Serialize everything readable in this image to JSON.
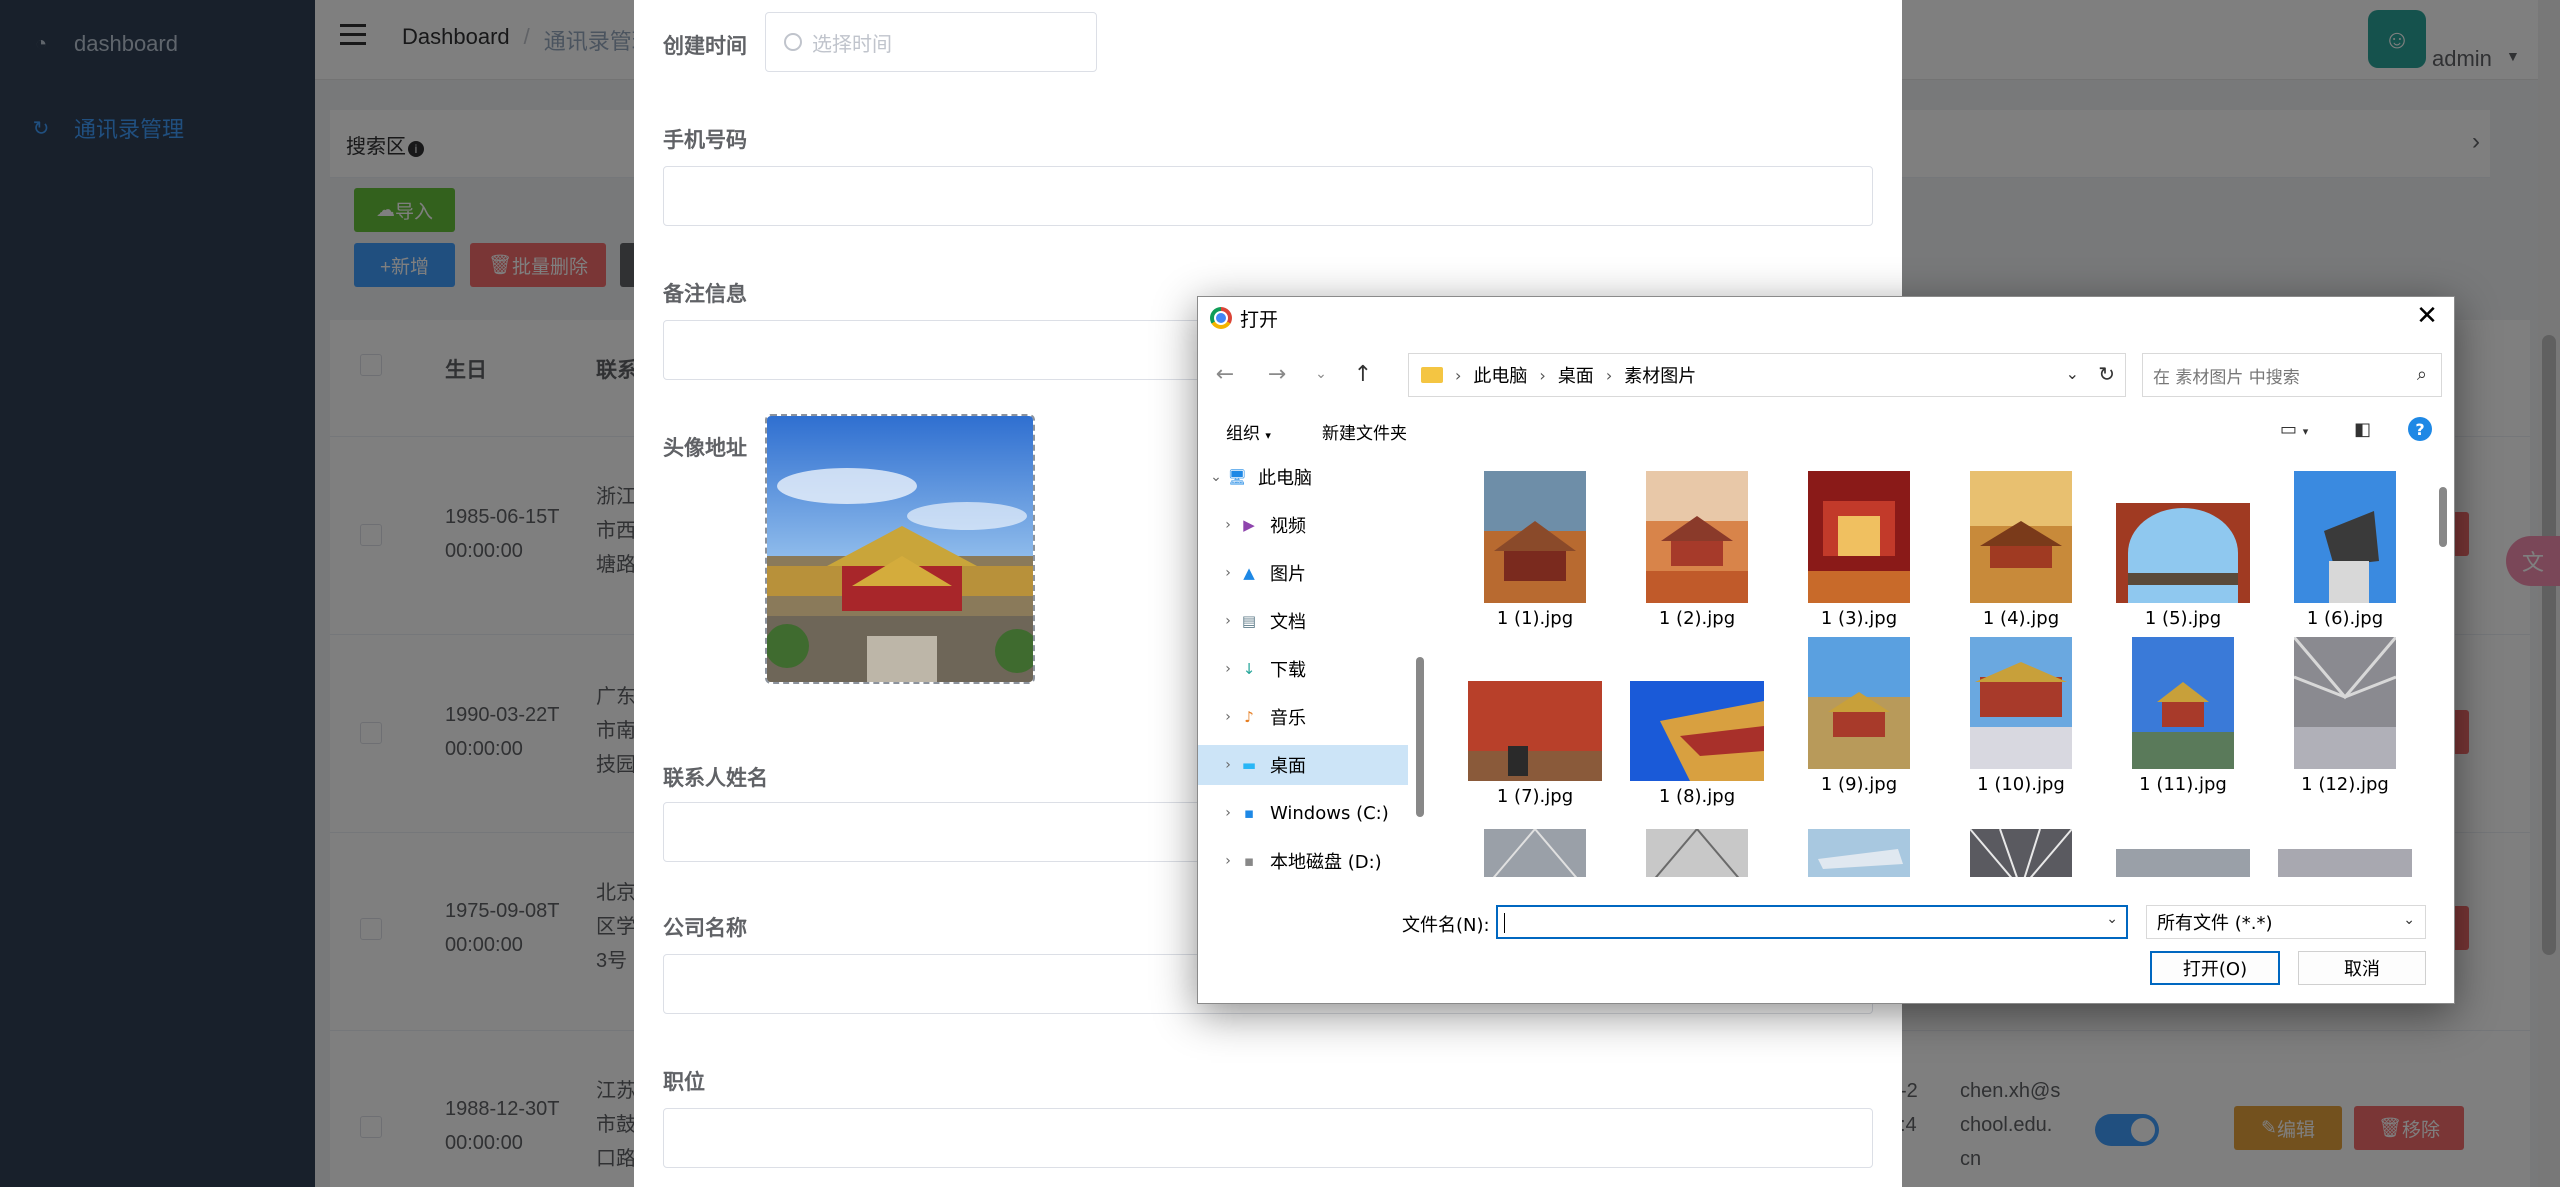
{
  "sidebar": {
    "items": [
      {
        "label": "dashboard",
        "icon": "dashboard-icon"
      },
      {
        "label": "通讯录管理",
        "icon": "contacts-icon"
      }
    ]
  },
  "header": {
    "breadcrumb": [
      "Dashboard",
      "通讯录管理"
    ],
    "user": "admin"
  },
  "search": {
    "title": "搜索区"
  },
  "toolbar": {
    "import_label": "导入",
    "add_label": "+新增",
    "batch_delete_label": "批量删除"
  },
  "table": {
    "headers": [
      "生日",
      "联系"
    ],
    "rows": [
      {
        "birthday": "1985-06-15T\n00:00:00",
        "address": "浙江\n市西\n塘路"
      },
      {
        "birthday": "1990-03-22T\n00:00:00",
        "address": "广东\n市南\n技园"
      },
      {
        "birthday": "1975-09-08T\n00:00:00",
        "address": "北京\n区学\n3号"
      },
      {
        "birthday": "1988-12-30T\n00:00:00",
        "address": "江苏\n市鼓\n口路",
        "email": "chen.xh@s\nchool.edu.\ncn",
        "date_frag": "-2\n:4"
      }
    ],
    "edit_label": "编辑",
    "remove_label": "移除"
  },
  "form": {
    "created_time_label": "创建时间",
    "created_time_placeholder": "选择时间",
    "phone_label": "手机号码",
    "remark_label": "备注信息",
    "avatar_label": "头像地址",
    "name_label": "联系人姓名",
    "company_label": "公司名称",
    "position_label": "职位"
  },
  "dialog": {
    "title": "打开",
    "path": [
      "此电脑",
      "桌面",
      "素材图片"
    ],
    "search_placeholder": "在 素材图片 中搜索",
    "organize": "组织",
    "new_folder": "新建文件夹",
    "tree": [
      {
        "label": "此电脑",
        "icon": "computer-icon"
      },
      {
        "label": "视频",
        "icon": "video-icon"
      },
      {
        "label": "图片",
        "icon": "pictures-icon"
      },
      {
        "label": "文档",
        "icon": "documents-icon"
      },
      {
        "label": "下载",
        "icon": "download-icon"
      },
      {
        "label": "音乐",
        "icon": "music-icon"
      },
      {
        "label": "桌面",
        "icon": "desktop-icon"
      },
      {
        "label": "Windows (C:)",
        "icon": "drive-icon"
      },
      {
        "label": "本地磁盘 (D:)",
        "icon": "drive-icon"
      }
    ],
    "files": [
      "1 (1).jpg",
      "1 (2).jpg",
      "1 (3).jpg",
      "1 (4).jpg",
      "1 (5).jpg",
      "1 (6).jpg",
      "1 (7).jpg",
      "1 (8).jpg",
      "1 (9).jpg",
      "1 (10).jpg",
      "1 (11).jpg",
      "1 (12).jpg"
    ],
    "filename_label": "文件名(N):",
    "filetype": "所有文件 (*.*)",
    "open_label": "打开(O)",
    "cancel_label": "取消"
  }
}
